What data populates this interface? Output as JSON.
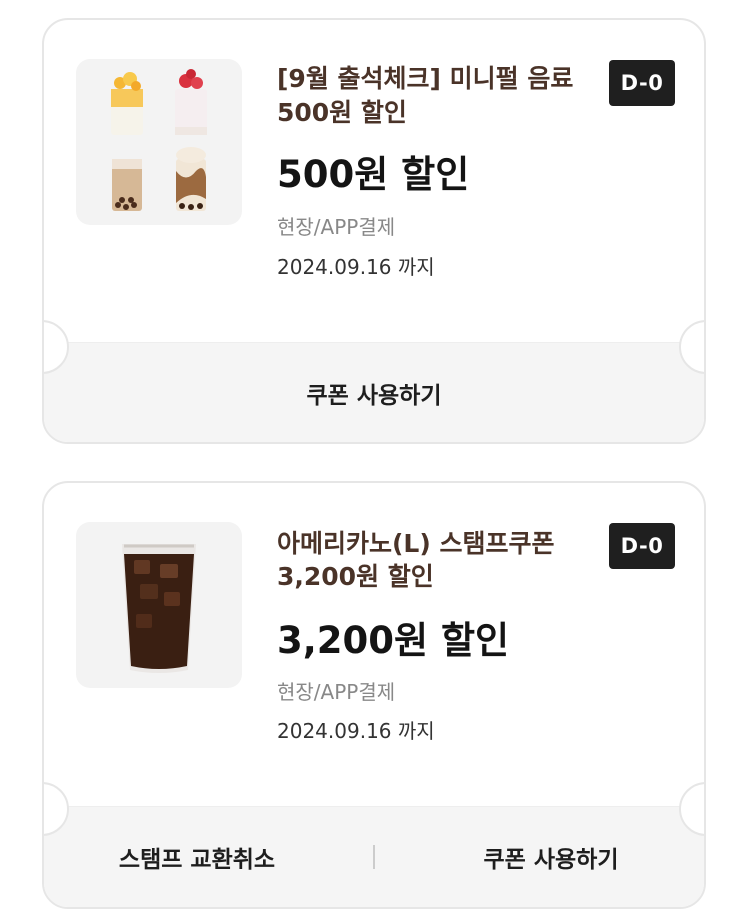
{
  "coupons": [
    {
      "title": "[9월 출석체크] 미니펄 음료\n500원 할인",
      "discount": "500원 할인",
      "payment": "현장/APP결제",
      "expiry": "2024.09.16 까지",
      "dday": "D-0",
      "buttons": [
        "쿠폰 사용하기"
      ]
    },
    {
      "title": "아메리카노(L) 스탬프쿠폰\n3,200원 할인",
      "discount": "3,200원 할인",
      "payment": "현장/APP결제",
      "expiry": "2024.09.16 까지",
      "dday": "D-0",
      "buttons": [
        "스탬프 교환취소",
        "쿠폰 사용하기"
      ]
    }
  ]
}
